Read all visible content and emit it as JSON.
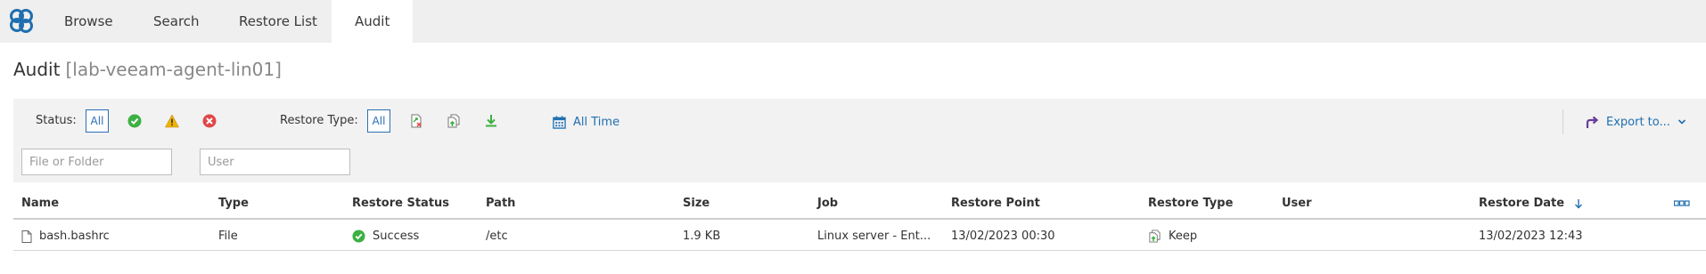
{
  "nav": {
    "tabs": [
      {
        "label": "Browse"
      },
      {
        "label": "Search"
      },
      {
        "label": "Restore List"
      },
      {
        "label": "Audit"
      }
    ]
  },
  "page": {
    "title": "Audit",
    "host": "[lab-veeam-agent-lin01]"
  },
  "filters": {
    "status_label": "Status:",
    "status_all": "All",
    "restore_type_label": "Restore Type:",
    "restore_type_all": "All",
    "time_range": "All Time",
    "export_label": "Export to...",
    "file_placeholder": "File or Folder",
    "user_placeholder": "User"
  },
  "table": {
    "columns": [
      "Name",
      "Type",
      "Restore Status",
      "Path",
      "Size",
      "Job",
      "Restore Point",
      "Restore Type",
      "User",
      "Restore Date"
    ],
    "rows": [
      {
        "name": "bash.bashrc",
        "type": "File",
        "status": "Success",
        "path": "/etc",
        "size": "1.9 KB",
        "job": "Linux server - Ent...",
        "restore_point": "13/02/2023 00:30",
        "restore_type": "Keep",
        "user": "",
        "restore_date": "13/02/2023 12:43"
      }
    ]
  },
  "colors": {
    "accent": "#1f6fb0",
    "success": "#3cb043",
    "warning": "#f0b400",
    "error": "#e04848",
    "export_arrow": "#6a3d9a"
  },
  "icons": {
    "logo": "veeam-logo-icon",
    "success": "check-circle-icon",
    "warning": "warning-icon",
    "error": "error-circle-icon",
    "calendar": "calendar-icon",
    "export": "export-arrow-icon",
    "columns": "column-chooser-icon",
    "file": "file-icon",
    "sort": "sort-down-arrow-icon"
  }
}
